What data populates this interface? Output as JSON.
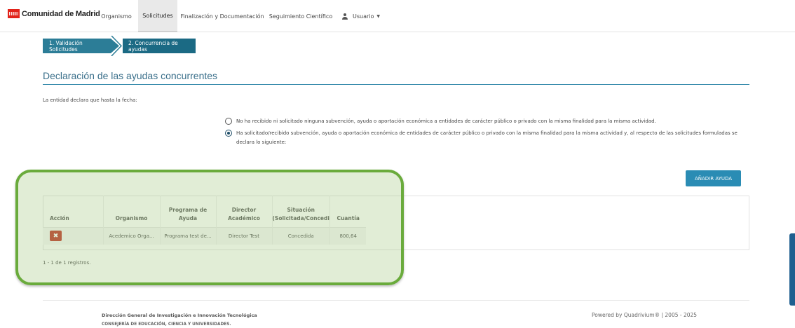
{
  "brand": {
    "name": "Comunidad de Madrid",
    "color": "#e2231a"
  },
  "nav": {
    "items": [
      {
        "label": "Organismo",
        "active": false
      },
      {
        "label": "Solicitudes",
        "active": true
      },
      {
        "label": "Finalización y Documentación",
        "active": false
      },
      {
        "label": "Seguimiento Científico",
        "active": false
      }
    ],
    "user_label": "Usuario"
  },
  "steps": [
    {
      "label": "1. Validación Solicitudes"
    },
    {
      "label": "2. Concurrencia de ayudas",
      "active": true
    }
  ],
  "page": {
    "title": "Declaración de las ayudas concurrentes",
    "declaration_intro": "La entidad declara que hasta la fecha:",
    "options": [
      {
        "label": "No ha recibido ni solicitado ninguna subvención, ayuda o aportación económica a entidades de carácter público o privado con la misma finalidad para la misma actividad.",
        "checked": false
      },
      {
        "label": "Ha solicitado/recibido subvención, ayuda o aportación económica de entidades de carácter público o privado con la misma finalidad para la misma actividad y, al respecto de las solicitudes formuladas se declara lo siguiente:",
        "checked": true
      }
    ],
    "add_button": "AÑADIR AYUDA"
  },
  "table": {
    "headers": {
      "accion": "Acción",
      "organismo": "Organismo",
      "programa_1": "Programa de",
      "programa_2": "Ayuda",
      "director_1": "Director",
      "director_2": "Académico",
      "situacion_1": "Situación",
      "situacion_2": "(Solicitada/Concedi",
      "cuantia": "Cuantía"
    },
    "rows": [
      {
        "organismo": "Acedemico Orga...",
        "programa": "Programa test de...",
        "director": "Director Test",
        "situacion": "Concedida",
        "cuantia": "800,64"
      }
    ],
    "records_text": "1 - 1 de 1 registros."
  },
  "footer": {
    "line1": "Dirección General de Investigación e Innovación Tecnológica",
    "line2": "CONSEJERÍA DE EDUCACIÓN, CIENCIA Y UNIVERSIDADES.",
    "powered": "Powered by Quadrivium® | 2005 - 2025"
  },
  "colors": {
    "accent": "#2c7d97",
    "highlight": "#6aab3c",
    "delete": "#c0392b"
  }
}
